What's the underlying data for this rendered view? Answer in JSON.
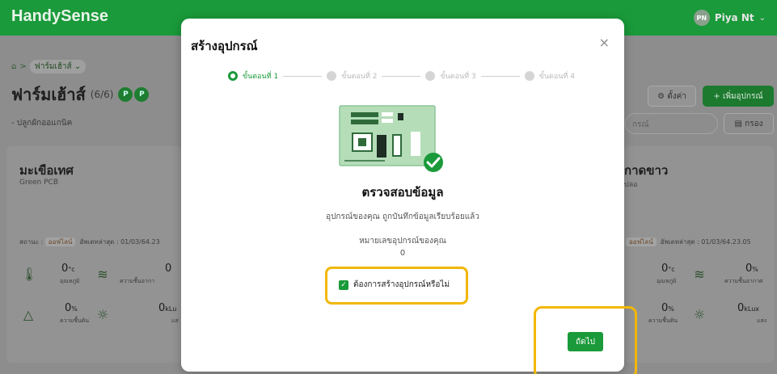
{
  "app": {
    "brand": "HandySense"
  },
  "user": {
    "initials": "PN",
    "name": "Piya Nt"
  },
  "breadcrumb": {
    "current": "ฟาร์มเฮ้าส์"
  },
  "farm": {
    "title": "ฟาร์มเฮ้าส์",
    "count": "(6/6)",
    "badges": [
      "P",
      "P"
    ],
    "subtitle": "- ปลูกผักออแกนิค"
  },
  "toolbar": {
    "settings_label": "ตั้งค่า",
    "add_label": "+ เพิ่มอุปกรณ์",
    "search_placeholder": "กรณ์",
    "filter_label": "กรอง"
  },
  "cards": {
    "left": {
      "title": "มะเขือเทศ",
      "subtitle": "Green PCB",
      "status_label": "สถานะ :",
      "status_value": "ออฟไลน์",
      "updated": "อัพเดทล่าสุด : 01/03/64.23",
      "temp": "0",
      "temp_unit": "°c",
      "temp_label": "อุณหภูมิ",
      "humid": "0",
      "humid_label": "ความชื้นอากา",
      "soil": "0",
      "soil_unit": "%",
      "soil_label": "ความชื้นดิน",
      "light": "0",
      "light_unit": "kLu",
      "light_label": "แส"
    },
    "right": {
      "title": "กาดขาว",
      "subtitle": "ปลอ",
      "status_value": "ออฟไลน์",
      "updated": "อัพเดทล่าสุด : 01/03/64.23.05",
      "temp": "0",
      "temp_unit": "°c",
      "temp_label": "อุณหภูมิ",
      "humid": "0",
      "humid_unit": "%",
      "humid_label": "ความชื้นอากาศ",
      "soil": "0",
      "soil_unit": "%",
      "soil_label": "ความชื้นดิน",
      "light": "0",
      "light_unit": "kLux",
      "light_label": "แสง"
    }
  },
  "modal": {
    "title": "สร้างอุปกรณ์",
    "close": "×",
    "steps": [
      "ขั้นตอนที่ 1",
      "ขั้นตอนที่ 2",
      "ขั้นตอนที่ 3",
      "ขั้นตอนที่ 4"
    ],
    "confirm_title": "ตรวจสอบข้อมูล",
    "confirm_desc": "อุปกรณ์ของคุณ ถูกบันทึกข้อมูลเรียบร้อยแล้ว",
    "id_label": "หมายเลขอุปกรณ์ของคุณ",
    "id_value": "0",
    "checkbox_label": "ต้องการสร้างอุปกรณ์หรือไม่",
    "next_label": "ถัดไป"
  },
  "colors": {
    "brand_green": "#1a9a3a",
    "highlight": "#f2b705"
  }
}
